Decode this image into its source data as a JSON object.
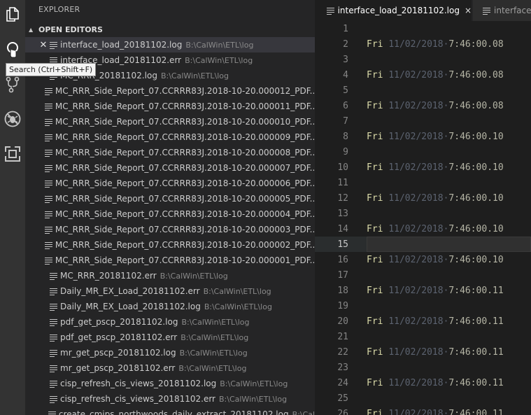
{
  "activity_bar": {
    "items": [
      {
        "name": "explorer",
        "icon": "files-icon"
      },
      {
        "name": "search",
        "icon": "search-icon"
      },
      {
        "name": "source-control",
        "icon": "source-control-icon"
      },
      {
        "name": "debug",
        "icon": "debug-icon"
      },
      {
        "name": "extensions",
        "icon": "extensions-icon"
      }
    ],
    "tooltip": "Search (Ctrl+Shift+F)"
  },
  "sidebar": {
    "title": "EXPLORER",
    "section_label": "OPEN EDITORS",
    "files": [
      {
        "name": "interface_load_20181102.log",
        "path": "B:\\CalWin\\ETL\\log",
        "active": true
      },
      {
        "name": "interface_load_20181102.err",
        "path": "B:\\CalWin\\ETL\\log"
      },
      {
        "name": "MC_RRR_20181102.log",
        "path": "B:\\CalWin\\ETL\\log"
      },
      {
        "name": "MC_RRR_Side_Report_07.CCRRR83J.2018-10-20.000012_PDF...",
        "path": ""
      },
      {
        "name": "MC_RRR_Side_Report_07.CCRRR83J.2018-10-20.000011_PDF...",
        "path": ""
      },
      {
        "name": "MC_RRR_Side_Report_07.CCRRR83J.2018-10-20.000010_PDF...",
        "path": ""
      },
      {
        "name": "MC_RRR_Side_Report_07.CCRRR83J.2018-10-20.000009_PDF...",
        "path": ""
      },
      {
        "name": "MC_RRR_Side_Report_07.CCRRR83J.2018-10-20.000008_PDF...",
        "path": ""
      },
      {
        "name": "MC_RRR_Side_Report_07.CCRRR83J.2018-10-20.000007_PDF...",
        "path": ""
      },
      {
        "name": "MC_RRR_Side_Report_07.CCRRR83J.2018-10-20.000006_PDF...",
        "path": ""
      },
      {
        "name": "MC_RRR_Side_Report_07.CCRRR83J.2018-10-20.000005_PDF...",
        "path": ""
      },
      {
        "name": "MC_RRR_Side_Report_07.CCRRR83J.2018-10-20.000004_PDF...",
        "path": ""
      },
      {
        "name": "MC_RRR_Side_Report_07.CCRRR83J.2018-10-20.000003_PDF...",
        "path": ""
      },
      {
        "name": "MC_RRR_Side_Report_07.CCRRR83J.2018-10-20.000002_PDF...",
        "path": ""
      },
      {
        "name": "MC_RRR_Side_Report_07.CCRRR83J.2018-10-20.000001_PDF...",
        "path": ""
      },
      {
        "name": "MC_RRR_20181102.err",
        "path": "B:\\CalWin\\ETL\\log"
      },
      {
        "name": "Daily_MR_EX_Load_20181102.err",
        "path": "B:\\CalWin\\ETL\\log"
      },
      {
        "name": "Daily_MR_EX_Load_20181102.log",
        "path": "B:\\CalWin\\ETL\\log"
      },
      {
        "name": "pdf_get_pscp_20181102.log",
        "path": "B:\\CalWin\\ETL\\log"
      },
      {
        "name": "pdf_get_pscp_20181102.err",
        "path": "B:\\CalWin\\ETL\\log"
      },
      {
        "name": "mr_get_pscp_20181102.log",
        "path": "B:\\CalWin\\ETL\\log"
      },
      {
        "name": "mr_get_pscp_20181102.err",
        "path": "B:\\CalWin\\ETL\\log"
      },
      {
        "name": "cisp_refresh_cis_views_20181102.log",
        "path": "B:\\CalWin\\ETL\\log"
      },
      {
        "name": "cisp_refresh_cis_views_20181102.err",
        "path": "B:\\CalWin\\ETL\\log"
      },
      {
        "name": "create_cmips_northwoods_daily_extract_20181102.log",
        "path": "B:\\Cal"
      }
    ]
  },
  "tabs": [
    {
      "label": "interface_load_20181102.log",
      "active": true,
      "close": "×"
    },
    {
      "label": "interface_",
      "active": false
    }
  ],
  "editor": {
    "current_line": 15,
    "lines": [
      {
        "n": "1",
        "day": "",
        "date": "",
        "time": ""
      },
      {
        "n": "2",
        "day": "Fri",
        "date": "11/02/2018",
        "time": "7:46:00.08"
      },
      {
        "n": "3",
        "day": "",
        "date": "",
        "time": ""
      },
      {
        "n": "4",
        "day": "Fri",
        "date": "11/02/2018",
        "time": "7:46:00.08"
      },
      {
        "n": "5",
        "day": "",
        "date": "",
        "time": ""
      },
      {
        "n": "6",
        "day": "Fri",
        "date": "11/02/2018",
        "time": "7:46:00.08"
      },
      {
        "n": "7",
        "day": "",
        "date": "",
        "time": ""
      },
      {
        "n": "8",
        "day": "Fri",
        "date": "11/02/2018",
        "time": "7:46:00.10"
      },
      {
        "n": "9",
        "day": "",
        "date": "",
        "time": ""
      },
      {
        "n": "10",
        "day": "Fri",
        "date": "11/02/2018",
        "time": "7:46:00.10"
      },
      {
        "n": "11",
        "day": "",
        "date": "",
        "time": ""
      },
      {
        "n": "12",
        "day": "Fri",
        "date": "11/02/2018",
        "time": "7:46:00.10"
      },
      {
        "n": "13",
        "day": "",
        "date": "",
        "time": ""
      },
      {
        "n": "14",
        "day": "Fri",
        "date": "11/02/2018",
        "time": "7:46:00.10"
      },
      {
        "n": "15",
        "day": "",
        "date": "",
        "time": ""
      },
      {
        "n": "16",
        "day": "Fri",
        "date": "11/02/2018",
        "time": "7:46:00.10"
      },
      {
        "n": "17",
        "day": "",
        "date": "",
        "time": ""
      },
      {
        "n": "18",
        "day": "Fri",
        "date": "11/02/2018",
        "time": "7:46:00.11"
      },
      {
        "n": "19",
        "day": "",
        "date": "",
        "time": ""
      },
      {
        "n": "20",
        "day": "Fri",
        "date": "11/02/2018",
        "time": "7:46:00.11"
      },
      {
        "n": "21",
        "day": "",
        "date": "",
        "time": ""
      },
      {
        "n": "22",
        "day": "Fri",
        "date": "11/02/2018",
        "time": "7:46:00.11"
      },
      {
        "n": "23",
        "day": "",
        "date": "",
        "time": ""
      },
      {
        "n": "24",
        "day": "Fri",
        "date": "11/02/2018",
        "time": "7:46:00.11"
      },
      {
        "n": "25",
        "day": "",
        "date": "",
        "time": ""
      },
      {
        "n": "26",
        "day": "Fri",
        "date": "11/02/2018",
        "time": "7:46:00.11"
      }
    ]
  },
  "colors": {
    "activity_bar": "#333333",
    "sidebar": "#252526",
    "editor": "#1e1e1e",
    "keyword": "#dcdcaa",
    "line_number": "#858585"
  }
}
